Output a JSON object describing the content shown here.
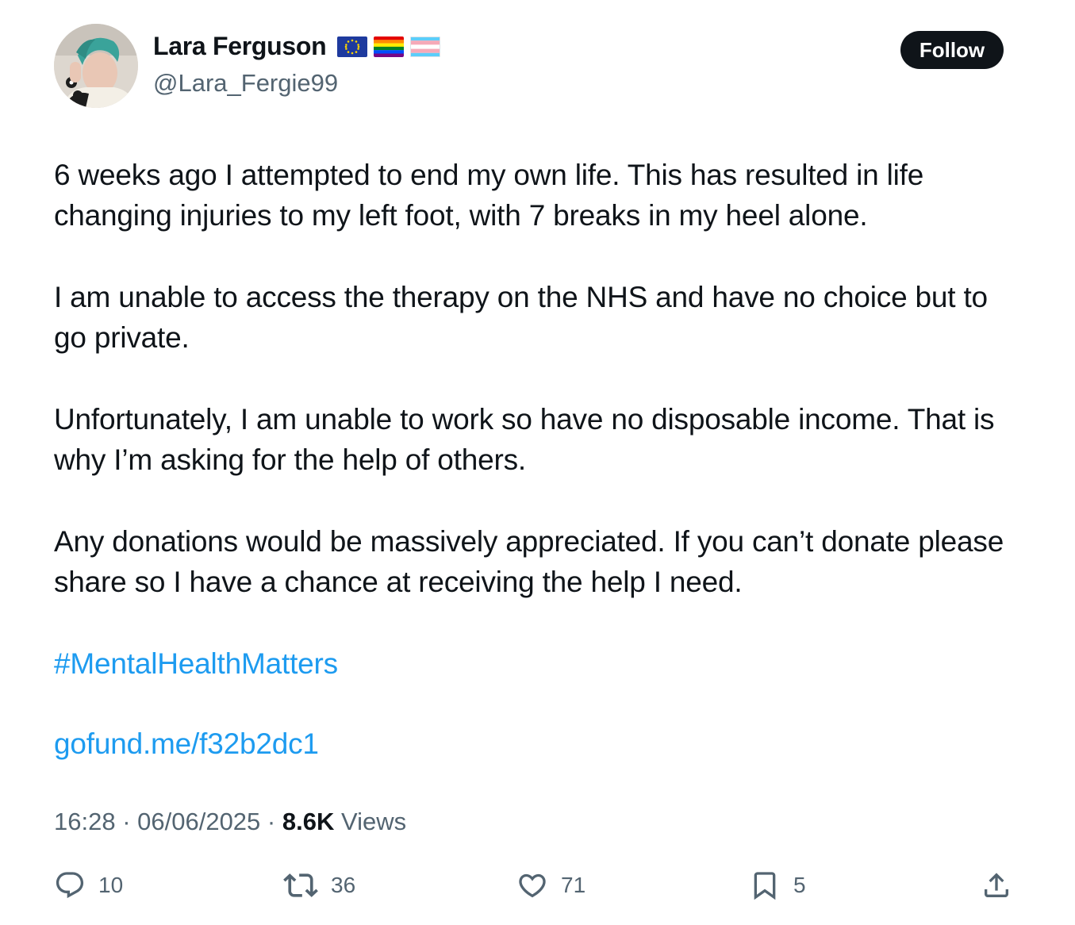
{
  "author": {
    "display_name": "Lara Ferguson",
    "handle": "@Lara_Fergie99",
    "flags": [
      "eu-flag-icon",
      "rainbow-flag-icon",
      "trans-flag-icon"
    ]
  },
  "follow_button": {
    "label": "Follow"
  },
  "tweet": {
    "paragraphs": [
      "6 weeks ago I attempted to end my own life. This has resulted in life changing injuries to my left foot, with 7 breaks in my heel alone.",
      "I am unable to access the therapy on the NHS and have no choice but to go private.",
      "Unfortunately, I am unable to work so have no disposable income. That is why I’m asking for the help of others.",
      "Any donations would be massively appreciated. If you can’t donate please share so I have a chance at receiving the help I need."
    ],
    "hashtag": "#MentalHealthMatters",
    "link": "gofund.me/f32b2dc1"
  },
  "meta": {
    "time": "16:28",
    "separator": " · ",
    "date": "06/06/2025",
    "views_count": "8.6K",
    "views_label": " Views"
  },
  "actions": {
    "replies": "10",
    "reposts": "36",
    "likes": "71",
    "bookmarks": "5"
  },
  "colors": {
    "link": "#1d9bf0",
    "text": "#0f1419",
    "secondary": "#536471",
    "button_bg": "#0f1419"
  }
}
